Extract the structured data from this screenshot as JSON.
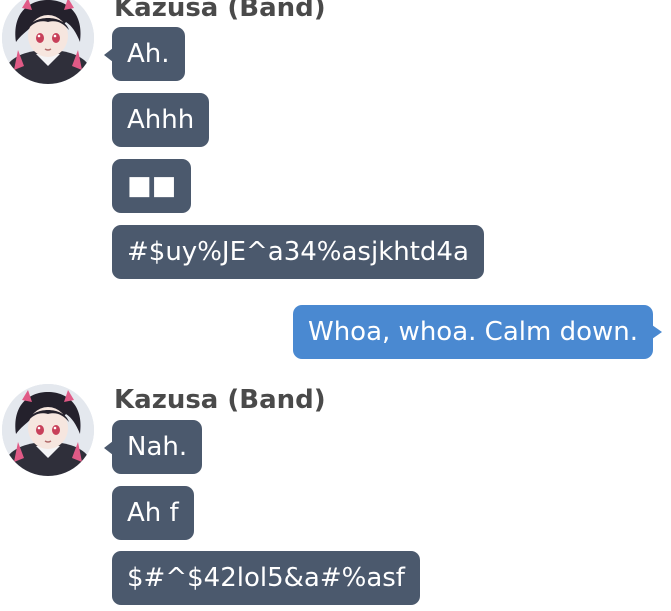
{
  "chat": {
    "group1": {
      "sender": "Kazusa (Band)",
      "messages": [
        "Ah.",
        "Ahhh",
        "■■",
        "#$uy%JE^a34%asjkhtd4a"
      ]
    },
    "outgoing": {
      "message": "Whoa, whoa. Calm down."
    },
    "group2": {
      "sender": "Kazusa (Band)",
      "messages": [
        "Nah.",
        "Ah f",
        "$#^$42lol5&a#%asf"
      ]
    }
  },
  "colors": {
    "incoming_bubble": "#4b596d",
    "outgoing_bubble": "#4a89d1",
    "sender_name": "#4a4a4a",
    "background": "#ffffff"
  },
  "icons": {
    "avatar": "character-portrait-icon"
  }
}
